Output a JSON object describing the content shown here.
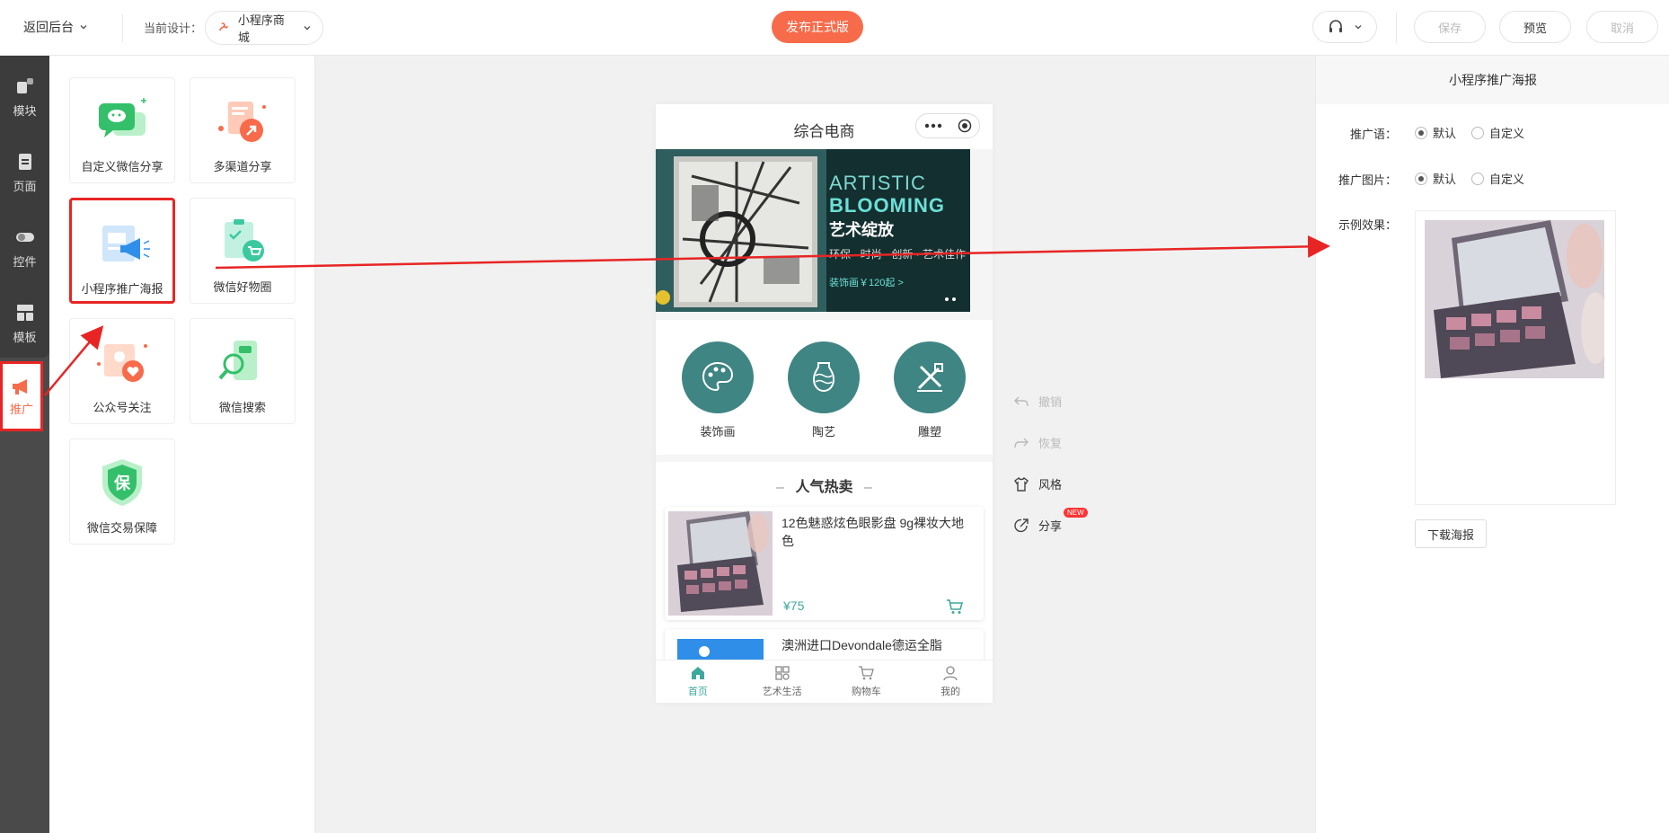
{
  "topbar": {
    "back_label": "返回后台",
    "design_label": "当前设计：",
    "design_value": "小程序商城",
    "publish_label": "发布正式版",
    "save_label": "保存",
    "preview_label": "预览",
    "cancel_label": "取消"
  },
  "leftnav": {
    "items": [
      {
        "label": "模块",
        "icon": "blocks-icon"
      },
      {
        "label": "页面",
        "icon": "page-icon"
      },
      {
        "label": "控件",
        "icon": "toggle-icon"
      },
      {
        "label": "模板",
        "icon": "template-icon"
      },
      {
        "label": "推广",
        "icon": "megaphone-icon"
      }
    ],
    "active": "推广"
  },
  "modules": [
    {
      "label": "自定义微信分享",
      "icon": "wechat-share-icon"
    },
    {
      "label": "多渠道分享",
      "icon": "multi-channel-share-icon"
    },
    {
      "label": "小程序推广海报",
      "icon": "poster-icon"
    },
    {
      "label": "微信好物圈",
      "icon": "wechat-goods-circle-icon"
    },
    {
      "label": "公众号关注",
      "icon": "follow-icon"
    },
    {
      "label": "微信搜索",
      "icon": "wechat-search-icon"
    },
    {
      "label": "微信交易保障",
      "icon": "trade-guarantee-icon"
    }
  ],
  "badge_char": "保",
  "phone": {
    "title": "综合电商",
    "banner": {
      "en1": "ARTISTIC",
      "en2": "BLOOMING",
      "cn": "艺术绽放",
      "tags": "环保 · 时尚 · 创新 · 艺术佳作",
      "price": "装饰画￥120起 >"
    },
    "categories": [
      "装饰画",
      "陶艺",
      "雕塑"
    ],
    "hot_title": "人气热卖",
    "products": [
      {
        "name": "12色魅惑炫色眼影盘 9g裸妆大地色",
        "price": "¥75"
      },
      {
        "name": "澳洲进口Devondale德运全脂",
        "price": ""
      }
    ],
    "tabs": [
      "首页",
      "艺术生活",
      "购物车",
      "我的"
    ]
  },
  "tools": {
    "undo": "撤销",
    "redo": "恢复",
    "style": "风格",
    "share": "分享",
    "new_badge": "NEW"
  },
  "right_panel": {
    "title": "小程序推广海报",
    "slogan_label": "推广语：",
    "image_label": "推广图片：",
    "example_label": "示例效果：",
    "opt_default": "默认",
    "opt_custom": "自定义",
    "download_label": "下载海报"
  },
  "colors": {
    "accent": "#f76b4b",
    "teal": "#3fa89c",
    "annotation_red": "#e82525"
  }
}
